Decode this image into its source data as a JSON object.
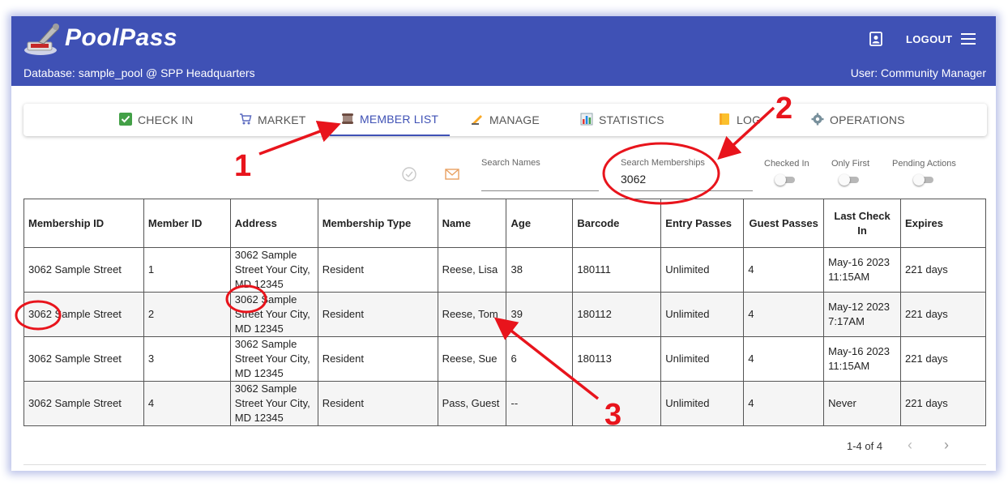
{
  "app": {
    "title": "PoolPass",
    "database": "Database: sample_pool @ SPP Headquarters",
    "user": "User: Community Manager",
    "logout": "LOGOUT"
  },
  "tabs": [
    {
      "label": "CHECK IN",
      "icon": "check-box-icon"
    },
    {
      "label": "MARKET",
      "icon": "cart-icon"
    },
    {
      "label": "MEMBER LIST",
      "icon": "scroll-icon"
    },
    {
      "label": "MANAGE",
      "icon": "writing-hand-icon"
    },
    {
      "label": "STATISTICS",
      "icon": "bar-chart-icon"
    },
    {
      "label": "LOG",
      "icon": "notebook-icon"
    },
    {
      "label": "OPERATIONS",
      "icon": "gear-icon"
    }
  ],
  "filters": {
    "search_names_label": "Search Names",
    "search_names_value": "",
    "search_memberships_label": "Search Memberships",
    "search_memberships_value": "3062",
    "checked_in": "Checked In",
    "only_first": "Only First",
    "pending_actions": "Pending Actions"
  },
  "table": {
    "headers": [
      "Membership ID",
      "Member ID",
      "Address",
      "Membership Type",
      "Name",
      "Age",
      "Barcode",
      "Entry Passes",
      "Guest Passes",
      "Last Check In",
      "Expires"
    ],
    "rows": [
      [
        "3062 Sample Street",
        "1",
        "3062 Sample Street Your City, MD 12345",
        "Resident",
        "Reese, Lisa",
        "38",
        "180111",
        "Unlimited",
        "4",
        "May-16 2023 11:15AM",
        "221 days"
      ],
      [
        "3062 Sample Street",
        "2",
        "3062 Sample Street Your City, MD 12345",
        "Resident",
        "Reese, Tom",
        "39",
        "180112",
        "Unlimited",
        "4",
        "May-12 2023 7:17AM",
        "221 days"
      ],
      [
        "3062 Sample Street",
        "3",
        "3062 Sample Street Your City, MD 12345",
        "Resident",
        "Reese, Sue",
        "6",
        "180113",
        "Unlimited",
        "4",
        "May-16 2023 11:15AM",
        "221 days"
      ],
      [
        "3062 Sample Street",
        "4",
        "3062 Sample Street Your City, MD 12345",
        "Resident",
        "Pass, Guest",
        "--",
        "",
        "Unlimited",
        "4",
        "Never",
        "221 days"
      ]
    ]
  },
  "pagination": {
    "text": "1-4 of 4",
    "prev": "‹",
    "next": "›"
  },
  "annotations": {
    "marker_1": "1",
    "marker_2": "2",
    "marker_3": "3",
    "color": "#e8141c"
  },
  "colors": {
    "primary": "#3f51b5",
    "annotation": "#e8141c"
  }
}
